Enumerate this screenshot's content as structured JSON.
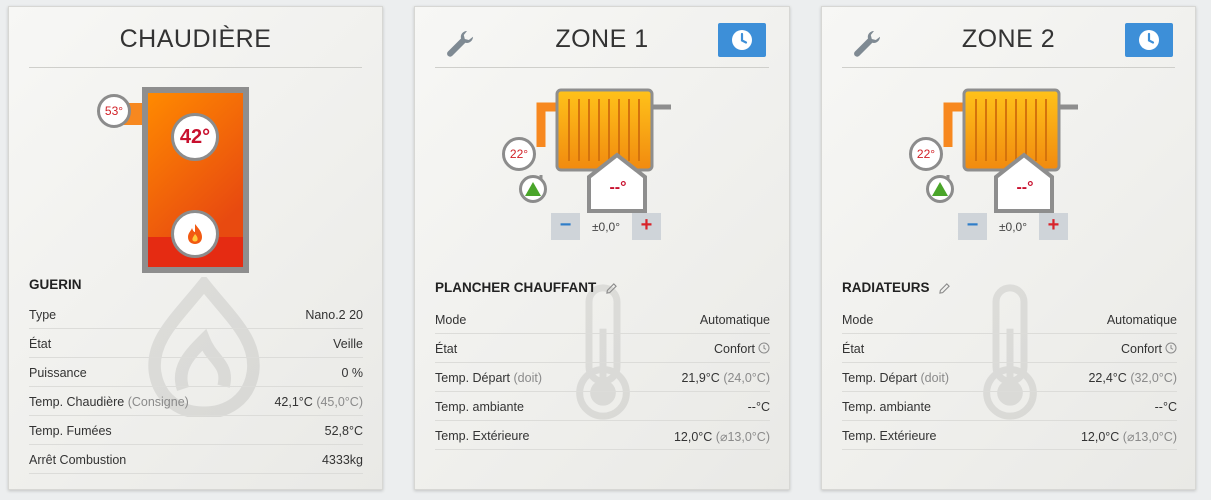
{
  "boiler": {
    "title": "CHAUDIÈRE",
    "flue_temp": "53°",
    "water_temp": "42°",
    "brand": "GUERIN",
    "rows": [
      {
        "label": "Type",
        "label_note": "",
        "value": "Nano.2 20",
        "value_note": ""
      },
      {
        "label": "État",
        "label_note": "",
        "value": "Veille",
        "value_note": ""
      },
      {
        "label": "Puissance",
        "label_note": "",
        "value": "0 %",
        "value_note": ""
      },
      {
        "label": "Temp. Chaudière",
        "label_note": "(Consigne)",
        "value": "42,1°C",
        "value_note": "(45,0°C)"
      },
      {
        "label": "Temp. Fumées",
        "label_note": "",
        "value": "52,8°C",
        "value_note": ""
      },
      {
        "label": "Arrêt Combustion",
        "label_note": "",
        "value": "4333kg",
        "value_note": ""
      }
    ]
  },
  "zone1": {
    "title": "ZONE 1",
    "pipe_temp": "22°",
    "room_temp": "--°",
    "offset": "±0,0°",
    "minus": "−",
    "plus": "+",
    "name": "PLANCHER CHAUFFANT",
    "rows": [
      {
        "label": "Mode",
        "label_note": "",
        "value": "Automatique",
        "value_note": ""
      },
      {
        "label": "État",
        "label_note": "",
        "value": "Confort",
        "value_note": ""
      },
      {
        "label": "Temp. Départ",
        "label_note": "(doit)",
        "value": "21,9°C",
        "value_note": "(24,0°C)"
      },
      {
        "label": "Temp. ambiante",
        "label_note": "",
        "value": "--°C",
        "value_note": ""
      },
      {
        "label": "Temp. Extérieure",
        "label_note": "",
        "value": "12,0°C",
        "value_note": "(⌀13,0°C)"
      }
    ]
  },
  "zone2": {
    "title": "ZONE 2",
    "pipe_temp": "22°",
    "room_temp": "--°",
    "offset": "±0,0°",
    "minus": "−",
    "plus": "+",
    "name": "RADIATEURS",
    "rows": [
      {
        "label": "Mode",
        "label_note": "",
        "value": "Automatique",
        "value_note": ""
      },
      {
        "label": "État",
        "label_note": "",
        "value": "Confort",
        "value_note": ""
      },
      {
        "label": "Temp. Départ",
        "label_note": "(doit)",
        "value": "22,4°C",
        "value_note": "(32,0°C)"
      },
      {
        "label": "Temp. ambiante",
        "label_note": "",
        "value": "--°C",
        "value_note": ""
      },
      {
        "label": "Temp. Extérieure",
        "label_note": "",
        "value": "12,0°C",
        "value_note": "(⌀13,0°C)"
      }
    ]
  },
  "icons": {
    "settings": "wrench-icon",
    "schedule": "clock-icon",
    "edit": "pencil-icon",
    "flame": "flame-icon",
    "pump": "pump-icon"
  },
  "colors": {
    "accent_blue": "#3d8fd8",
    "boiler_orange": "#f7881f",
    "alert_red": "#c8102e",
    "pump_green": "#4aa52a"
  }
}
